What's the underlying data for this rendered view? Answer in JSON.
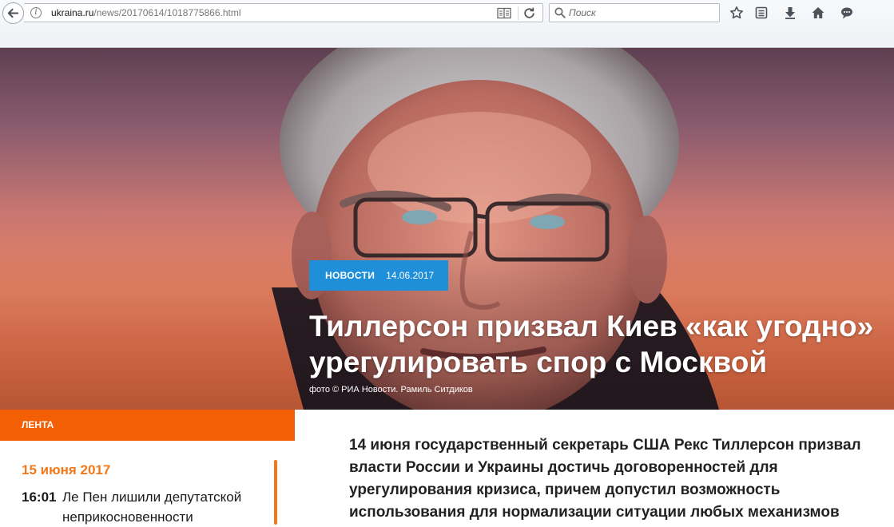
{
  "browser": {
    "url_domain": "ukraina.ru",
    "url_path": "/news/20170614/1018775866.html",
    "search_placeholder": "Поиск",
    "icons": [
      "back-arrow-icon",
      "info-icon",
      "reader-view-icon",
      "reload-icon",
      "search-icon",
      "bookmark-star-icon",
      "bookmarks-list-icon",
      "download-icon",
      "home-icon",
      "chat-icon"
    ]
  },
  "article": {
    "category": "НОВОСТИ",
    "date": "14.06.2017",
    "headline": "Тиллерсон призвал Киев «как угодно» урегулировать спор с Москвой",
    "photo_credit": "фото © РИА Новости. Рамиль Ситдиков",
    "lead": "14 июня государственный секретарь США Рекс Тиллерсон призвал власти России и Украины достичь договоренностей для урегулирования кризиса, причем допустил возможность использования для нормализации ситуации любых механизмов"
  },
  "lenta": {
    "title": "ЛЕНТА",
    "date": "15 июня 2017",
    "items": [
      {
        "time": "16:01",
        "text": "Ле Пен лишили депутатской неприкосновенности"
      }
    ]
  },
  "colors": {
    "accent_orange": "#f25f05",
    "date_orange": "#f1791b",
    "tag_blue": "#1e8fd8"
  }
}
